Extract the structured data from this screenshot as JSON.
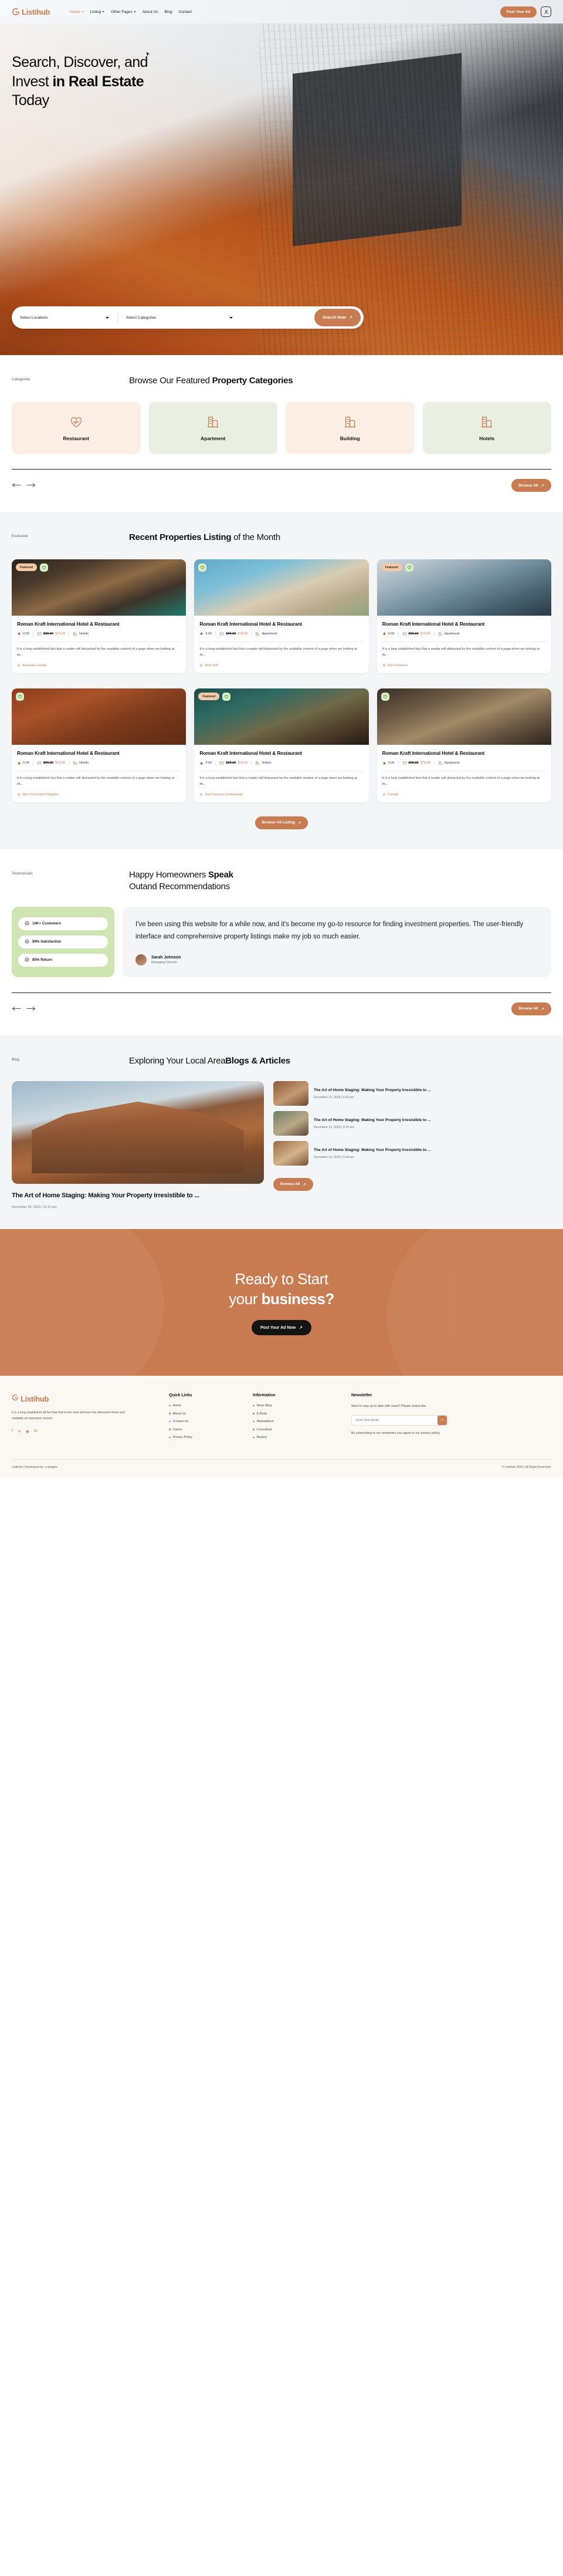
{
  "brand": {
    "name": "Listihub",
    "accent": "#c97b52"
  },
  "header": {
    "nav": [
      {
        "label": "Home",
        "caret": true,
        "active": true
      },
      {
        "label": "Listing",
        "caret": true,
        "active": false
      },
      {
        "label": "Other Pages",
        "caret": true,
        "active": false
      },
      {
        "label": "About Us",
        "caret": false,
        "active": false
      },
      {
        "label": "Blog",
        "caret": false,
        "active": false
      },
      {
        "label": "Contact",
        "caret": false,
        "active": false
      }
    ],
    "cta_label": "Post Your Ad"
  },
  "hero": {
    "title_line1": "Search, Discover, and",
    "title_line2_plain": "Invest ",
    "title_line2_bold": "in Real Estate",
    "title_line3": "Today",
    "search": {
      "location_value": "Select Locations",
      "category_value": "Select Categories",
      "button_label": "Search Now"
    }
  },
  "categories_section": {
    "eyebrow": "Categories",
    "title_plain": "Browse Our Featured ",
    "title_bold": "Property Categories",
    "browse_label": "Browse All",
    "items": [
      {
        "label": "Restaurant",
        "icon": "heart-pulse-icon",
        "bg": "#fbeee4"
      },
      {
        "label": "Apartment",
        "icon": "building-icon",
        "bg": "#e9f0e1"
      },
      {
        "label": "Building",
        "icon": "building-icon",
        "bg": "#fbeee4"
      },
      {
        "label": "Hotels",
        "icon": "building-icon",
        "bg": "#e9f0e1"
      }
    ]
  },
  "listings_section": {
    "eyebrow": "Exclusive",
    "title_bold": "Recent Properties Listing",
    "title_plain": " of the Month",
    "browse_label": "Browse All Listing",
    "cards": [
      {
        "title": "Roman Kraft International Hotel & Restaurant",
        "rating": "0.00",
        "price_old": "$99.00",
        "price_new": "$79.00",
        "category": "Hotels",
        "desc": "It is a long established fact that a reader will distracted by the readable content of a page when we looking at its...",
        "location": "Australia,Canada",
        "featured": true,
        "img": "linear-gradient(160deg,#2a2320 0%,#4a3a2c 26%,#8d6a45 50%,#3d3229 72%,#1f7a6c 100%)"
      },
      {
        "title": "Roman Kraft International Hotel & Restaurant",
        "rating": "0.00",
        "price_old": "$99.00",
        "price_new": "$79.00",
        "category": "Apartment",
        "desc": "It is a long established fact that a reader will distracted by the readable content of a page when we looking at its...",
        "location": "New York",
        "featured": false,
        "img": "linear-gradient(160deg,#5fa8c8 0%,#7ec0d8 30%,#d9cdb4 55%,#b8a98e 78%,#8fa27f 100%)"
      },
      {
        "title": "Roman Kraft International Hotel & Restaurant",
        "rating": "0.00",
        "price_old": "$99.00",
        "price_new": "$79.00",
        "category": "Apartment",
        "desc": "It is a long established fact that a reader will distracted by the readable content of a page when we looking at its...",
        "location": "San Francisco",
        "featured": true,
        "img": "linear-gradient(160deg,#cfd8dd 0%,#9fb2bd 28%,#6f8a99 52%,#47606e 76%,#2b3a44 100%)"
      },
      {
        "title": "Roman Kraft International Hotel & Restaurant",
        "rating": "0.00",
        "price_old": "$99.00",
        "price_new": "$79.00",
        "category": "Hotels",
        "desc": "It is a long established fact that a reader will distracted by the readable content of a page when we looking at its...",
        "location": "New York,United Kingdom",
        "featured": false,
        "img": "linear-gradient(160deg,#8d3c1d 0%,#a9532a 30%,#7d3b1c 60%,#5e2c14 100%)"
      },
      {
        "title": "Roman Kraft International Hotel & Restaurant",
        "rating": "0.00",
        "price_old": "$99.00",
        "price_new": "$79.00",
        "category": "Hotels",
        "desc": "It is a long established fact that a reader will distracted by the readable content of a page when we looking at its...",
        "location": "San Francisco,Switzerland",
        "featured": true,
        "img": "linear-gradient(160deg,#1d4a4a 0%,#2f6b63 28%,#6f6a4a 55%,#4a3a28 80%,#241c14 100%)"
      },
      {
        "title": "Roman Kraft International Hotel & Restaurant",
        "rating": "0.00",
        "price_old": "$99.00",
        "price_new": "$79.00",
        "category": "Apartment",
        "desc": "It is a long established fact that a reader will distracted by the readable content of a page when we looking at its...",
        "location": "Canada",
        "featured": false,
        "img": "linear-gradient(160deg,#3a3027 0%,#6b5a46 28%,#a08a68 52%,#5e4e3c 78%,#2d251c 100%)"
      }
    ]
  },
  "testimonials_section": {
    "eyebrow": "Testimonials",
    "title_plain_1": "Happy Homeowners ",
    "title_bold": "Speak",
    "title_plain_2": "Outand Recommendations",
    "browse_label": "Browse All",
    "stats": [
      {
        "label": "10K+ Customers"
      },
      {
        "label": "99% Satisfaction"
      },
      {
        "label": "85% Return"
      }
    ],
    "quote": "I've been using this website for a while now, and it's become my go-to resource for finding investment properties. The user-friendly interface and comprehensive property listings make my job so much easier.",
    "author_name": "Sarah Johnson",
    "author_role": "Managing Director"
  },
  "blog_section": {
    "eyebrow": "Blog",
    "title_plain": "Exploring Your Local Area",
    "title_bold": "Blogs & Articles",
    "browse_label": "Browse All",
    "featured": {
      "title": "The Art of Home Staging: Making Your Property Irresistible to ...",
      "date": "December 24, 2023 | 11:15 pm"
    },
    "items": [
      {
        "title": "The Art of Home Staging: Making Your Property Irresistible to ...",
        "date": "December 13, 2023 | 9:20 am",
        "thumb": "linear-gradient(150deg,#8a5a3a,#c49a72 55%,#6b4a30)"
      },
      {
        "title": "The Art of Home Staging: Making Your Property Irresistible to ...",
        "date": "December 13, 2023 | 9:19 am",
        "thumb": "linear-gradient(150deg,#6f7f6a,#b9a887 55%,#5c4a36)"
      },
      {
        "title": "The Art of Home Staging: Making Your Property Irresistible to ...",
        "date": "December 13, 2023 | 9:18 am",
        "thumb": "linear-gradient(150deg,#9a6b45,#d2b48c 55%,#7a5434)"
      }
    ]
  },
  "cta_section": {
    "line1": "Ready to Start",
    "line2_plain": "your ",
    "line2_bold": "business?",
    "button_label": "Post Your Ad Now"
  },
  "footer": {
    "about": "It is a long established all fact that that to the read will been the distracted these and readable an important content.",
    "social": [
      "facebook-icon",
      "twitter-icon",
      "instagram-icon",
      "linkedin-icon"
    ],
    "quick_links": {
      "heading": "Quick Links",
      "items": [
        "Home",
        "About Us",
        "Contact Us",
        "Career",
        "Privacy Policy"
      ]
    },
    "information": {
      "heading": "Information",
      "items": [
        "News Blog",
        "E-Book",
        "Marketplace",
        "Consultant",
        "Review"
      ]
    },
    "newsletter": {
      "heading": "Newsletter",
      "text": "Want to stay up to date with news? Please Subscribe.",
      "placeholder": "Enter Your Email",
      "fine_print": "By subscribing to our newsletter you agree to our privacy policy."
    },
    "bottom_left": "Listihub | Developed by- a plugins",
    "bottom_right": "© Listihub 2024 | All Right Reserved."
  }
}
